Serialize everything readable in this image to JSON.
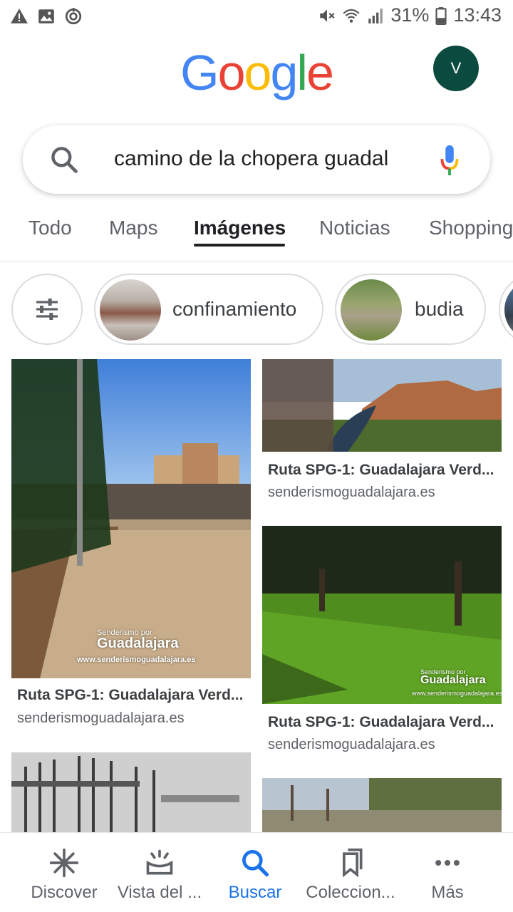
{
  "status_bar": {
    "battery": "31%",
    "time": "13:43"
  },
  "header": {
    "logo_letters": [
      "G",
      "o",
      "o",
      "g",
      "l",
      "e"
    ],
    "logo_colors": [
      "#4285F4",
      "#EA4335",
      "#FBBC05",
      "#4285F4",
      "#34A853",
      "#EA4335"
    ],
    "avatar_initial": "V"
  },
  "search": {
    "query": "camino de la chopera guadal"
  },
  "tabs": [
    {
      "label": "Todo"
    },
    {
      "label": "Maps"
    },
    {
      "label": "Imágenes",
      "active": true
    },
    {
      "label": "Noticias"
    },
    {
      "label": "Shopping"
    }
  ],
  "chips": [
    {
      "label": "confinamiento"
    },
    {
      "label": "budia"
    }
  ],
  "results": [
    {
      "title": "Ruta SPG-1: Guadalajara Verd...",
      "source": "senderismoguadalajara.es",
      "watermark_small": "Senderismo por",
      "watermark_big": "Guadalajara",
      "watermark_url": "www.senderismoguadalajara.es"
    },
    {
      "title": "Ruta SPG-1: Guadalajara Verd...",
      "source": "senderismoguadalajara.es"
    },
    {
      "title": "Ruta SPG-1: Guadalajara Verd...",
      "source": "senderismoguadalajara.es",
      "watermark_small": "Senderismo por",
      "watermark_big": "Guadalajara",
      "watermark_url": "www.senderismoguadalajara.es"
    }
  ],
  "bottom_nav": [
    {
      "label": "Discover",
      "icon": "discover-icon"
    },
    {
      "label": "Vista del ...",
      "icon": "snapshot-icon"
    },
    {
      "label": "Buscar",
      "icon": "search-icon",
      "active": true
    },
    {
      "label": "Coleccion...",
      "icon": "collections-icon"
    },
    {
      "label": "Más",
      "icon": "more-icon"
    }
  ],
  "colors": {
    "accent": "#1a73e8",
    "avatar_bg": "#0b4b3f"
  }
}
